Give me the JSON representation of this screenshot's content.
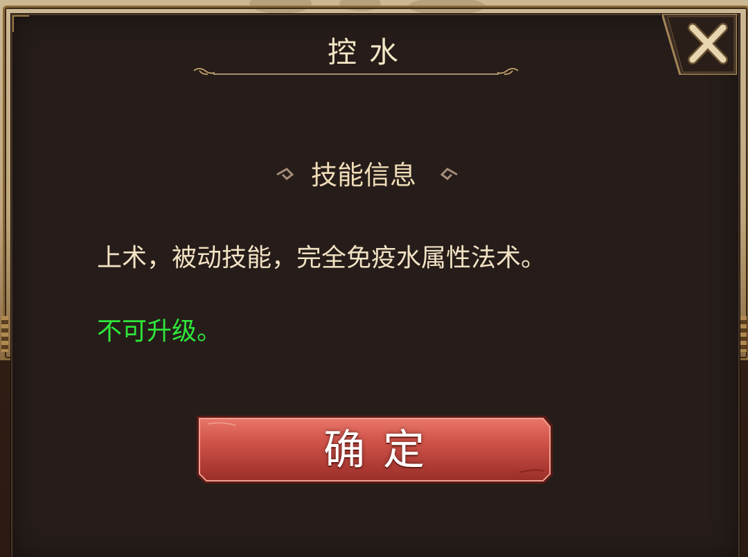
{
  "dialog": {
    "title": "控水",
    "close_icon": "close-x-icon"
  },
  "section": {
    "title": "技能信息"
  },
  "skill": {
    "description": "上术，被动技能，完全免疫水属性法术。",
    "upgrade_note": "不可升级。"
  },
  "confirm": {
    "label": "确定"
  },
  "colors": {
    "panel": "#261d1a",
    "title_text": "#f3e6c6",
    "body_text": "#f2e2c4",
    "note_green": "#2ee83a",
    "button_red": "#c8443a",
    "gold": "#b89a64"
  }
}
